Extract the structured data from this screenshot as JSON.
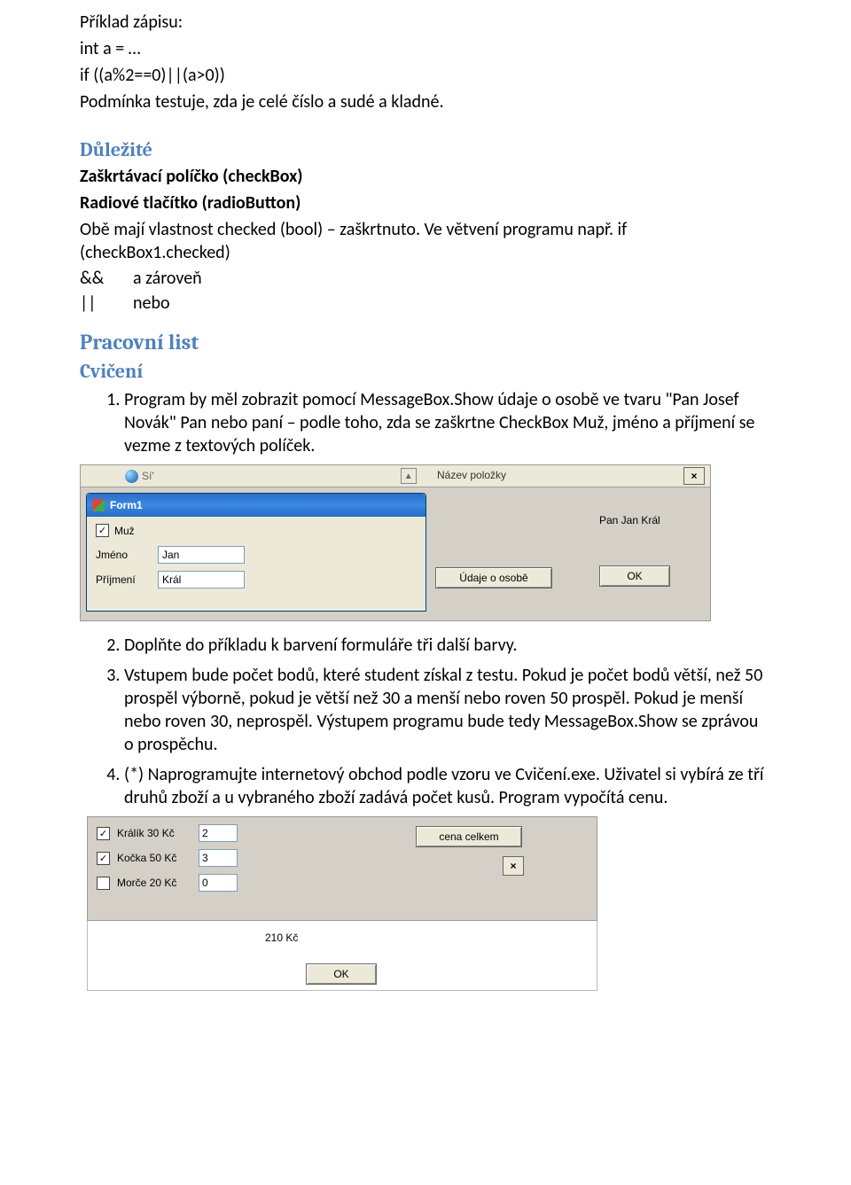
{
  "intro": {
    "priklad": "Příklad zápisu:",
    "line1": "int a = …",
    "line2": "if ((a%2==0)||(a>0))",
    "line3": "Podmínka testuje, zda je  celé číslo a sudé a kladné."
  },
  "dulezite": {
    "heading": "Důležité",
    "l1": "Zaškrtávací políčko (checkBox)",
    "l2": "Radiové tlačítko (radioButton)",
    "l3": "Obě mají vlastnost checked  (bool) – zaškrtnuto.  Ve větvení programu např. if (checkBox1.checked)",
    "op1a": "&&",
    "op1b": "a zároveň",
    "op2a": "||",
    "op2b": "nebo"
  },
  "pracovni": "Pracovní list",
  "cviceni_h": "Cvičení",
  "ex": [
    "Program by měl zobrazit pomocí MessageBox.Show údaje o osobě ve tvaru \"Pan Josef Novák\" Pan nebo paní – podle toho, zda se zaškrtne CheckBox Muž, jméno a příjmení se vezme z textových políček.",
    "Doplňte do příkladu k barvení formuláře tři další barvy.",
    "Vstupem bude počet bodů, které student získal z testu. Pokud je počet bodů větší, než 50 prospěl výborně, pokud je větší než 30 a menší nebo roven 50 prospěl. Pokud je menší nebo roven 30, neprospěl. Výstupem programu bude tedy MessageBox.Show se zprávou o prospěchu.",
    "(*) Naprogramujte internetový obchod podle vzoru ve Cvičení.exe. Uživatel si vybírá ze tří druhů zboží a  u vybraného zboží zadává počet kusů. Program vypočítá cenu."
  ],
  "shot1": {
    "topbar": {
      "site_abbrev": "Sí'",
      "nazev": "Název položky",
      "up": "▲",
      "x": "×"
    },
    "form_title": "Form1",
    "cb_label": "Muž",
    "cb_checked": "✓",
    "jmeno_lbl": "Jméno",
    "jmeno_val": "Jan",
    "prijmeni_lbl": "Příjmení",
    "prijmeni_val": "Král",
    "btn_info": "Údaje o osobě",
    "popup_text": "Pan Jan Král",
    "ok": "OK"
  },
  "shot2": {
    "items": [
      {
        "label": "Králík 30 Kč",
        "checked": true,
        "qty": "2"
      },
      {
        "label": "Kočka 50 Kč",
        "checked": true,
        "qty": "3"
      },
      {
        "label": "Morče 20 Kč",
        "checked": false,
        "qty": "0"
      }
    ],
    "check": "✓",
    "btn_cena": "cena celkem",
    "x": "×",
    "price": "210 Kč",
    "ok": "OK"
  }
}
